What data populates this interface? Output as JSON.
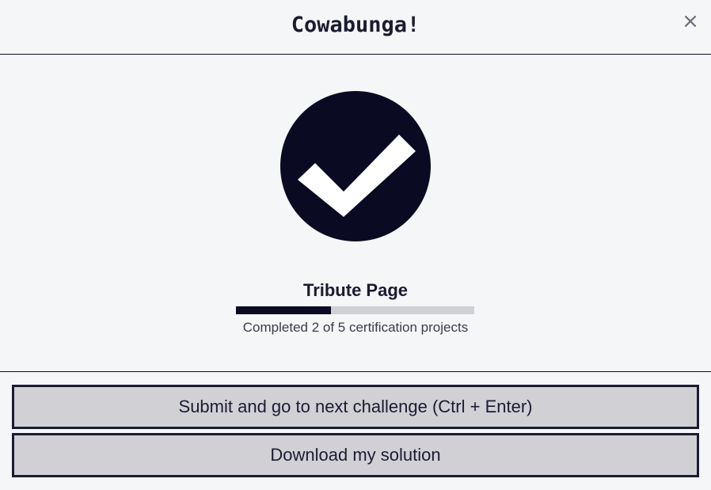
{
  "modal": {
    "title": "Cowabunga!",
    "close_symbol": "×",
    "close_icon": "close-icon"
  },
  "completion": {
    "icon": "checkmark-circle-icon",
    "icon_color": "#0a0a23",
    "project_title": "Tribute Page",
    "completed": 2,
    "total": 5,
    "progress_text": "Completed 2 of 5 certification projects"
  },
  "footer": {
    "submit_label": "Submit and go to next challenge (Ctrl + Enter)",
    "download_label": "Download my solution"
  }
}
